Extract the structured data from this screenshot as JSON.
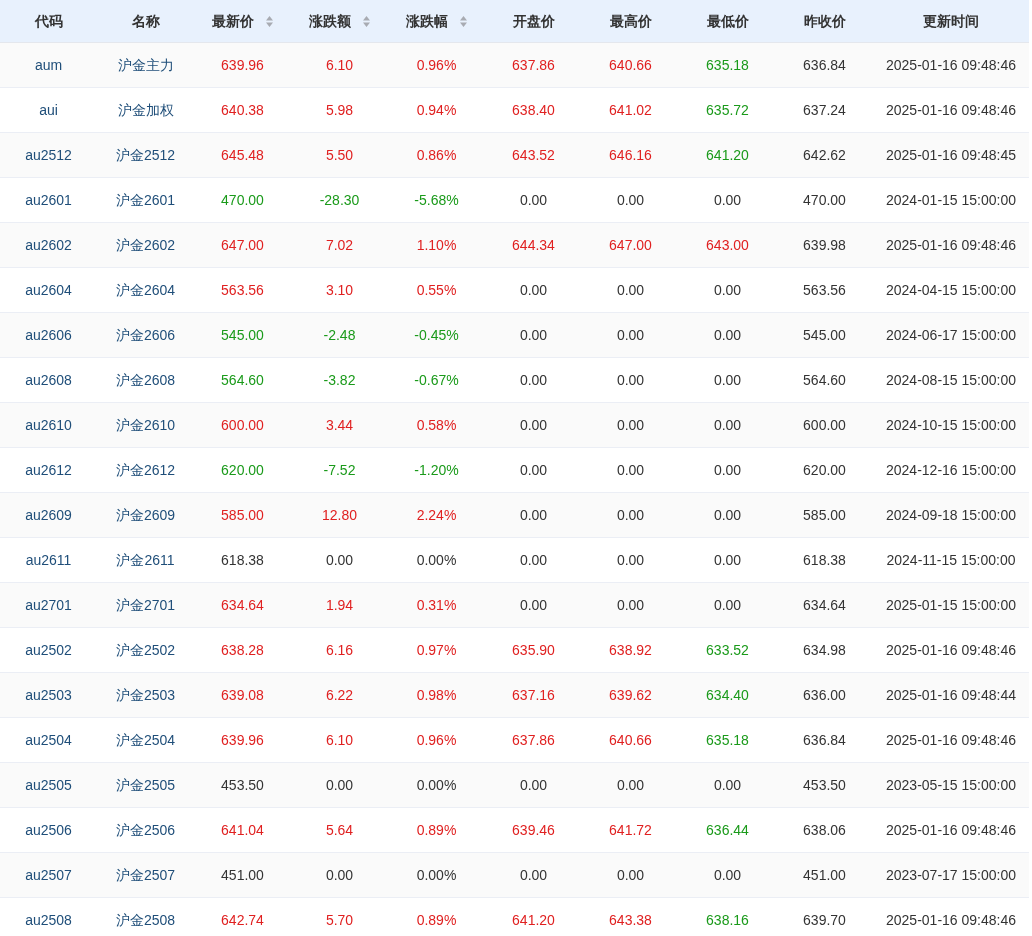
{
  "columns": [
    {
      "label": "代码",
      "sortable": false
    },
    {
      "label": "名称",
      "sortable": false
    },
    {
      "label": "最新价",
      "sortable": true
    },
    {
      "label": "涨跌额",
      "sortable": true
    },
    {
      "label": "涨跌幅",
      "sortable": true
    },
    {
      "label": "开盘价",
      "sortable": false
    },
    {
      "label": "最高价",
      "sortable": false
    },
    {
      "label": "最低价",
      "sortable": false
    },
    {
      "label": "昨收价",
      "sortable": false
    },
    {
      "label": "更新时间",
      "sortable": false
    }
  ],
  "rows": [
    {
      "code": "aum",
      "name": "沪金主力",
      "cells": [
        {
          "text": "639.96",
          "color": "#e02020"
        },
        {
          "text": "6.10",
          "color": "#e02020"
        },
        {
          "text": "0.96%",
          "color": "#e02020"
        },
        {
          "text": "637.86",
          "color": "#e02020"
        },
        {
          "text": "640.66",
          "color": "#e02020"
        },
        {
          "text": "635.18",
          "color": "#1a9a1a"
        }
      ],
      "prev_close": "636.84",
      "time": "2025-01-16 09:48:46"
    },
    {
      "code": "aui",
      "name": "沪金加权",
      "cells": [
        {
          "text": "640.38",
          "color": "#e02020"
        },
        {
          "text": "5.98",
          "color": "#e02020"
        },
        {
          "text": "0.94%",
          "color": "#e02020"
        },
        {
          "text": "638.40",
          "color": "#e02020"
        },
        {
          "text": "641.02",
          "color": "#e02020"
        },
        {
          "text": "635.72",
          "color": "#1a9a1a"
        }
      ],
      "prev_close": "637.24",
      "time": "2025-01-16 09:48:46"
    },
    {
      "code": "au2512",
      "name": "沪金2512",
      "cells": [
        {
          "text": "645.48",
          "color": "#e02020"
        },
        {
          "text": "5.50",
          "color": "#e02020"
        },
        {
          "text": "0.86%",
          "color": "#e02020"
        },
        {
          "text": "643.52",
          "color": "#e02020"
        },
        {
          "text": "646.16",
          "color": "#e02020"
        },
        {
          "text": "641.20",
          "color": "#1a9a1a"
        }
      ],
      "prev_close": "642.62",
      "time": "2025-01-16 09:48:45"
    },
    {
      "code": "au2601",
      "name": "沪金2601",
      "cells": [
        {
          "text": "470.00",
          "color": "#1a9a1a"
        },
        {
          "text": "-28.30",
          "color": "#1a9a1a"
        },
        {
          "text": "-5.68%",
          "color": "#1a9a1a"
        },
        {
          "text": "0.00",
          "color": "#333333"
        },
        {
          "text": "0.00",
          "color": "#333333"
        },
        {
          "text": "0.00",
          "color": "#333333"
        }
      ],
      "prev_close": "470.00",
      "time": "2024-01-15 15:00:00"
    },
    {
      "code": "au2602",
      "name": "沪金2602",
      "cells": [
        {
          "text": "647.00",
          "color": "#e02020"
        },
        {
          "text": "7.02",
          "color": "#e02020"
        },
        {
          "text": "1.10%",
          "color": "#e02020"
        },
        {
          "text": "644.34",
          "color": "#e02020"
        },
        {
          "text": "647.00",
          "color": "#e02020"
        },
        {
          "text": "643.00",
          "color": "#e02020"
        }
      ],
      "prev_close": "639.98",
      "time": "2025-01-16 09:48:46"
    },
    {
      "code": "au2604",
      "name": "沪金2604",
      "cells": [
        {
          "text": "563.56",
          "color": "#e02020"
        },
        {
          "text": "3.10",
          "color": "#e02020"
        },
        {
          "text": "0.55%",
          "color": "#e02020"
        },
        {
          "text": "0.00",
          "color": "#333333"
        },
        {
          "text": "0.00",
          "color": "#333333"
        },
        {
          "text": "0.00",
          "color": "#333333"
        }
      ],
      "prev_close": "563.56",
      "time": "2024-04-15 15:00:00"
    },
    {
      "code": "au2606",
      "name": "沪金2606",
      "cells": [
        {
          "text": "545.00",
          "color": "#1a9a1a"
        },
        {
          "text": "-2.48",
          "color": "#1a9a1a"
        },
        {
          "text": "-0.45%",
          "color": "#1a9a1a"
        },
        {
          "text": "0.00",
          "color": "#333333"
        },
        {
          "text": "0.00",
          "color": "#333333"
        },
        {
          "text": "0.00",
          "color": "#333333"
        }
      ],
      "prev_close": "545.00",
      "time": "2024-06-17 15:00:00"
    },
    {
      "code": "au2608",
      "name": "沪金2608",
      "cells": [
        {
          "text": "564.60",
          "color": "#1a9a1a"
        },
        {
          "text": "-3.82",
          "color": "#1a9a1a"
        },
        {
          "text": "-0.67%",
          "color": "#1a9a1a"
        },
        {
          "text": "0.00",
          "color": "#333333"
        },
        {
          "text": "0.00",
          "color": "#333333"
        },
        {
          "text": "0.00",
          "color": "#333333"
        }
      ],
      "prev_close": "564.60",
      "time": "2024-08-15 15:00:00"
    },
    {
      "code": "au2610",
      "name": "沪金2610",
      "cells": [
        {
          "text": "600.00",
          "color": "#e02020"
        },
        {
          "text": "3.44",
          "color": "#e02020"
        },
        {
          "text": "0.58%",
          "color": "#e02020"
        },
        {
          "text": "0.00",
          "color": "#333333"
        },
        {
          "text": "0.00",
          "color": "#333333"
        },
        {
          "text": "0.00",
          "color": "#333333"
        }
      ],
      "prev_close": "600.00",
      "time": "2024-10-15 15:00:00"
    },
    {
      "code": "au2612",
      "name": "沪金2612",
      "cells": [
        {
          "text": "620.00",
          "color": "#1a9a1a"
        },
        {
          "text": "-7.52",
          "color": "#1a9a1a"
        },
        {
          "text": "-1.20%",
          "color": "#1a9a1a"
        },
        {
          "text": "0.00",
          "color": "#333333"
        },
        {
          "text": "0.00",
          "color": "#333333"
        },
        {
          "text": "0.00",
          "color": "#333333"
        }
      ],
      "prev_close": "620.00",
      "time": "2024-12-16 15:00:00"
    },
    {
      "code": "au2609",
      "name": "沪金2609",
      "cells": [
        {
          "text": "585.00",
          "color": "#e02020"
        },
        {
          "text": "12.80",
          "color": "#e02020"
        },
        {
          "text": "2.24%",
          "color": "#e02020"
        },
        {
          "text": "0.00",
          "color": "#333333"
        },
        {
          "text": "0.00",
          "color": "#333333"
        },
        {
          "text": "0.00",
          "color": "#333333"
        }
      ],
      "prev_close": "585.00",
      "time": "2024-09-18 15:00:00"
    },
    {
      "code": "au2611",
      "name": "沪金2611",
      "cells": [
        {
          "text": "618.38",
          "color": "#333333"
        },
        {
          "text": "0.00",
          "color": "#333333"
        },
        {
          "text": "0.00%",
          "color": "#333333"
        },
        {
          "text": "0.00",
          "color": "#333333"
        },
        {
          "text": "0.00",
          "color": "#333333"
        },
        {
          "text": "0.00",
          "color": "#333333"
        }
      ],
      "prev_close": "618.38",
      "time": "2024-11-15 15:00:00"
    },
    {
      "code": "au2701",
      "name": "沪金2701",
      "cells": [
        {
          "text": "634.64",
          "color": "#e02020"
        },
        {
          "text": "1.94",
          "color": "#e02020"
        },
        {
          "text": "0.31%",
          "color": "#e02020"
        },
        {
          "text": "0.00",
          "color": "#333333"
        },
        {
          "text": "0.00",
          "color": "#333333"
        },
        {
          "text": "0.00",
          "color": "#333333"
        }
      ],
      "prev_close": "634.64",
      "time": "2025-01-15 15:00:00"
    },
    {
      "code": "au2502",
      "name": "沪金2502",
      "cells": [
        {
          "text": "638.28",
          "color": "#e02020"
        },
        {
          "text": "6.16",
          "color": "#e02020"
        },
        {
          "text": "0.97%",
          "color": "#e02020"
        },
        {
          "text": "635.90",
          "color": "#e02020"
        },
        {
          "text": "638.92",
          "color": "#e02020"
        },
        {
          "text": "633.52",
          "color": "#1a9a1a"
        }
      ],
      "prev_close": "634.98",
      "time": "2025-01-16 09:48:46"
    },
    {
      "code": "au2503",
      "name": "沪金2503",
      "cells": [
        {
          "text": "639.08",
          "color": "#e02020"
        },
        {
          "text": "6.22",
          "color": "#e02020"
        },
        {
          "text": "0.98%",
          "color": "#e02020"
        },
        {
          "text": "637.16",
          "color": "#e02020"
        },
        {
          "text": "639.62",
          "color": "#e02020"
        },
        {
          "text": "634.40",
          "color": "#1a9a1a"
        }
      ],
      "prev_close": "636.00",
      "time": "2025-01-16 09:48:44"
    },
    {
      "code": "au2504",
      "name": "沪金2504",
      "cells": [
        {
          "text": "639.96",
          "color": "#e02020"
        },
        {
          "text": "6.10",
          "color": "#e02020"
        },
        {
          "text": "0.96%",
          "color": "#e02020"
        },
        {
          "text": "637.86",
          "color": "#e02020"
        },
        {
          "text": "640.66",
          "color": "#e02020"
        },
        {
          "text": "635.18",
          "color": "#1a9a1a"
        }
      ],
      "prev_close": "636.84",
      "time": "2025-01-16 09:48:46"
    },
    {
      "code": "au2505",
      "name": "沪金2505",
      "cells": [
        {
          "text": "453.50",
          "color": "#333333"
        },
        {
          "text": "0.00",
          "color": "#333333"
        },
        {
          "text": "0.00%",
          "color": "#333333"
        },
        {
          "text": "0.00",
          "color": "#333333"
        },
        {
          "text": "0.00",
          "color": "#333333"
        },
        {
          "text": "0.00",
          "color": "#333333"
        }
      ],
      "prev_close": "453.50",
      "time": "2023-05-15 15:00:00"
    },
    {
      "code": "au2506",
      "name": "沪金2506",
      "cells": [
        {
          "text": "641.04",
          "color": "#e02020"
        },
        {
          "text": "5.64",
          "color": "#e02020"
        },
        {
          "text": "0.89%",
          "color": "#e02020"
        },
        {
          "text": "639.46",
          "color": "#e02020"
        },
        {
          "text": "641.72",
          "color": "#e02020"
        },
        {
          "text": "636.44",
          "color": "#1a9a1a"
        }
      ],
      "prev_close": "638.06",
      "time": "2025-01-16 09:48:46"
    },
    {
      "code": "au2507",
      "name": "沪金2507",
      "cells": [
        {
          "text": "451.00",
          "color": "#333333"
        },
        {
          "text": "0.00",
          "color": "#333333"
        },
        {
          "text": "0.00%",
          "color": "#333333"
        },
        {
          "text": "0.00",
          "color": "#333333"
        },
        {
          "text": "0.00",
          "color": "#333333"
        },
        {
          "text": "0.00",
          "color": "#333333"
        }
      ],
      "prev_close": "451.00",
      "time": "2023-07-17 15:00:00"
    },
    {
      "code": "au2508",
      "name": "沪金2508",
      "cells": [
        {
          "text": "642.74",
          "color": "#e02020"
        },
        {
          "text": "5.70",
          "color": "#e02020"
        },
        {
          "text": "0.89%",
          "color": "#e02020"
        },
        {
          "text": "641.20",
          "color": "#e02020"
        },
        {
          "text": "643.38",
          "color": "#e02020"
        },
        {
          "text": "638.16",
          "color": "#1a9a1a"
        }
      ],
      "prev_close": "639.70",
      "time": "2025-01-16 09:48:46"
    }
  ]
}
